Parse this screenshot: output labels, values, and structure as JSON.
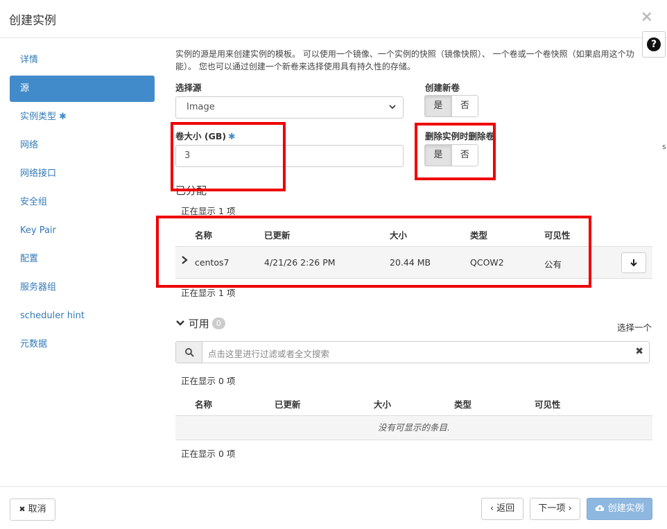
{
  "modal": {
    "title": "创建实例",
    "close_symbol": "×",
    "help_symbol": "?"
  },
  "sidebar": {
    "items": [
      {
        "label": "详情",
        "required": false,
        "active": false
      },
      {
        "label": "源",
        "required": false,
        "active": true
      },
      {
        "label": "实例类型",
        "required": true,
        "active": false
      },
      {
        "label": "网络",
        "required": false,
        "active": false
      },
      {
        "label": "网络接口",
        "required": false,
        "active": false
      },
      {
        "label": "安全组",
        "required": false,
        "active": false
      },
      {
        "label": "Key Pair",
        "required": false,
        "active": false
      },
      {
        "label": "配置",
        "required": false,
        "active": false
      },
      {
        "label": "服务器组",
        "required": false,
        "active": false
      },
      {
        "label": "scheduler hint",
        "required": false,
        "active": false
      },
      {
        "label": "元数据",
        "required": false,
        "active": false
      }
    ],
    "required_mark": "✱"
  },
  "source": {
    "description": "实例的源是用来创建实例的模板。 可以使用一个镜像、一个实例的快照（镜像快照）、 一个卷或一个卷快照（如果启用这个功能）。 您也可以通过创建一个新卷来选择使用具有持久性的存储。",
    "select_source_label": "选择源",
    "select_source_value": "Image",
    "create_volume_label": "创建新卷",
    "create_volume_yes": "是",
    "create_volume_no": "否",
    "volume_size_label": "卷大小 (GB)",
    "volume_size_value": "3",
    "delete_on_terminate_label": "删除实例时删除卷",
    "delete_yes": "是",
    "delete_no": "否"
  },
  "allocated": {
    "title": "已分配",
    "showing_top": "正在显示 1 项",
    "showing_bottom": "正在显示 1 项",
    "columns": [
      "名称",
      "已更新",
      "大小",
      "类型",
      "可见性"
    ],
    "rows": [
      {
        "name": "centos7",
        "updated": "4/21/26 2:26 PM",
        "size": "20.44 MB",
        "type": "QCOW2",
        "visibility": "公有"
      }
    ]
  },
  "available": {
    "title": "可用",
    "count": "0",
    "select_one": "选择一个",
    "search_placeholder": "点击这里进行过滤或者全文搜索",
    "clear_symbol": "✖",
    "showing_top": "正在显示 0 项",
    "showing_bottom": "正在显示 0 项",
    "columns": [
      "名称",
      "已更新",
      "大小",
      "类型",
      "可见性"
    ],
    "empty_text": "没有可显示的条目."
  },
  "footer": {
    "cancel": "取消",
    "cancel_symbol": "✖",
    "back": "‹ 返回",
    "next": "下一项 ›",
    "create": "创建实例"
  },
  "colors": {
    "accent": "#428bca",
    "annotation_red": "#ee0000",
    "primary_disabled": "#8fb8e0"
  },
  "edge_glyph": "s"
}
